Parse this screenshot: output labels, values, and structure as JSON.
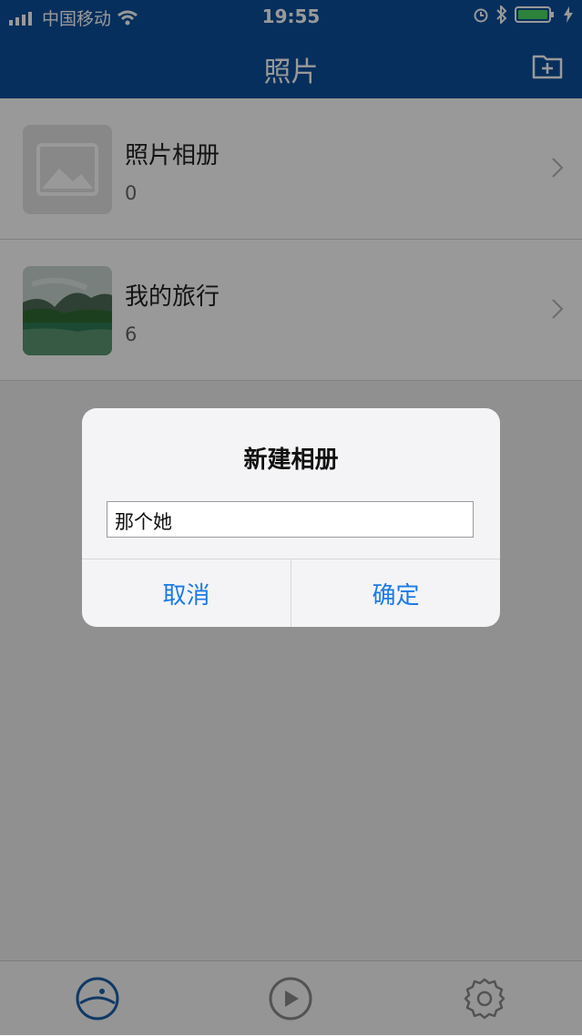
{
  "status": {
    "carrier": "中国移动",
    "time": "19:55"
  },
  "nav": {
    "title": "照片",
    "add_icon": "folder-add-icon"
  },
  "albums": [
    {
      "name": "照片相册",
      "count": "0",
      "thumb": "placeholder-image-icon"
    },
    {
      "name": "我的旅行",
      "count": "6",
      "thumb": "landscape-photo"
    }
  ],
  "dialog": {
    "title": "新建相册",
    "input_value": "那个她",
    "cancel_label": "取消",
    "confirm_label": "确定"
  },
  "tabs": [
    {
      "icon": "photos-tab-icon",
      "active": true
    },
    {
      "icon": "play-tab-icon",
      "active": false
    },
    {
      "icon": "settings-tab-icon",
      "active": false
    }
  ],
  "colors": {
    "nav": "#0d4f9c",
    "accent": "#1a7ae6",
    "tab_active": "#1b5fa8",
    "tab_inactive": "#8a8a8a"
  }
}
